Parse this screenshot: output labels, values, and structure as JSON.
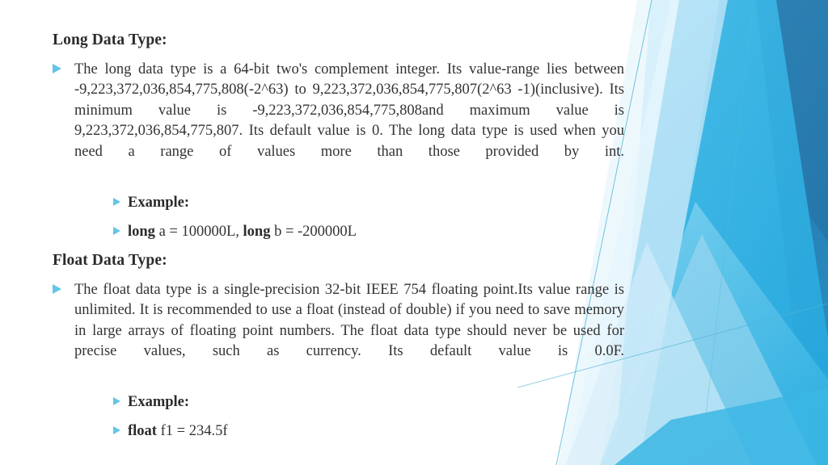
{
  "slide": {
    "background_color": "#ffffff",
    "accent_colors": {
      "bullet_marker": "#62c6e8",
      "deep_blue": "#2a79ae",
      "mid_blue": "#2badde",
      "sky_blue": "#6fcbee",
      "pale_blue": "#bfe5f5",
      "faint_blue": "#e2f3fb",
      "hairline": "#5cb9d8"
    }
  },
  "sections": [
    {
      "heading": "Long Data Type:",
      "body": "The long data type is a 64-bit two's complement integer. Its value-range lies between -9,223,372,036,854,775,808(-2^63) to 9,223,372,036,854,775,807(2^63 -1)(inclusive). Its minimum value is -9,223,372,036,854,775,808and maximum value is 9,223,372,036,854,775,807. Its default value is 0. The long data type is used when you need a range of values more than those provided by int.",
      "example_label": "Example:",
      "code_keyword_1": "long",
      "code_part_1": " a = 100000L, ",
      "code_keyword_2": "long",
      "code_part_2": " b = -200000L"
    },
    {
      "heading": "Float Data Type:",
      "body": "The float data type is a single-precision 32-bit IEEE 754 floating point.Its value range is unlimited. It is recommended to use a float (instead of double) if you need to save memory in large arrays of floating point numbers. The float data type should never be used for precise values, such as currency. Its default value is 0.0F.",
      "example_label": "Example:",
      "code_keyword_1": "float",
      "code_part_1": " f1 = 234.5f"
    }
  ]
}
